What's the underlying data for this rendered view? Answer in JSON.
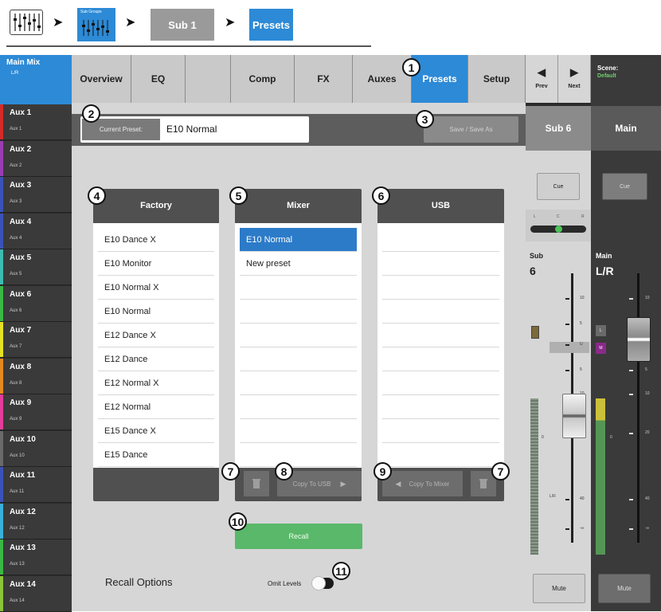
{
  "breadcrumb": {
    "subgroups_label": "Sub Groups",
    "sub_label": "Sub 1",
    "presets_label": "Presets"
  },
  "colors": {
    "accent": "#2d8ad6",
    "recall": "#5ab86a",
    "panel": "#505050"
  },
  "sidebar": {
    "main": {
      "name": "Main Mix",
      "sub": "L/R"
    },
    "items": [
      {
        "name": "Aux 1",
        "sub": "Aux 1",
        "color": "#d42a2a"
      },
      {
        "name": "Aux 2",
        "sub": "Aux 2",
        "color": "#9a3db3"
      },
      {
        "name": "Aux 3",
        "sub": "Aux 3",
        "color": "#3a52b8"
      },
      {
        "name": "Aux 4",
        "sub": "Aux 4",
        "color": "#3a52b8"
      },
      {
        "name": "Aux 5",
        "sub": "Aux 5",
        "color": "#3dbbb1"
      },
      {
        "name": "Aux 6",
        "sub": "Aux 6",
        "color": "#3ab845"
      },
      {
        "name": "Aux 7",
        "sub": "Aux 7",
        "color": "#e6e024"
      },
      {
        "name": "Aux 8",
        "sub": "Aux 8",
        "color": "#e38a1e"
      },
      {
        "name": "Aux 9",
        "sub": "Aux 9",
        "color": "#e23c9a"
      },
      {
        "name": "Aux 10",
        "sub": "Aux 10",
        "color": "#6a6a6a"
      },
      {
        "name": "Aux 11",
        "sub": "Aux 11",
        "color": "#3a52b8"
      },
      {
        "name": "Aux 12",
        "sub": "Aux 12",
        "color": "#3ab0d8"
      },
      {
        "name": "Aux 13",
        "sub": "Aux 13",
        "color": "#3ab845"
      },
      {
        "name": "Aux 14",
        "sub": "Aux 14",
        "color": "#8ac43a"
      }
    ]
  },
  "tabs": [
    "Overview",
    "EQ",
    "",
    "Comp",
    "FX",
    "Auxes",
    "Presets",
    "Setup"
  ],
  "nav": {
    "prev": "Prev",
    "next": "Next"
  },
  "scene": {
    "label": "Scene:",
    "value": "Default"
  },
  "preset": {
    "current_label": "Current Preset:",
    "current_value": "E10 Normal",
    "save_label": "Save / Save As"
  },
  "factory": {
    "title": "Factory",
    "items": [
      "E10 Dance X",
      "E10 Monitor",
      "E10 Normal X",
      "E10 Normal",
      "E12 Dance X",
      "E12 Dance",
      "E12 Normal X",
      "E12 Normal",
      "E15 Dance X",
      "E15 Dance"
    ]
  },
  "mixer": {
    "title": "Mixer",
    "items": [
      "E10 Normal",
      "New preset"
    ],
    "copy_label": "Copy To USB"
  },
  "usb": {
    "title": "USB",
    "copy_label": "Copy To Mixer"
  },
  "recall": {
    "label": "Recall",
    "options_label": "Recall Options",
    "omit_label": "Omit Levels"
  },
  "strip_sub": {
    "title": "Sub 6",
    "cue": "Cue",
    "name": "Sub",
    "num": "6",
    "meter_label": "L/R",
    "mute": "Mute",
    "pan_l": "L",
    "pan_c": "C",
    "pan_r": "R"
  },
  "strip_main": {
    "title": "Main",
    "cue": "Cue",
    "name": "Main",
    "num": "L/R",
    "mute": "Mute",
    "l_label": "L",
    "m_label": "M"
  },
  "scale": {
    "t10": "10",
    "t5": "5",
    "u": "U",
    "t5b": "5",
    "t10b": "10",
    "t20": "20",
    "t40": "40",
    "inf": "-∞",
    "zero": "0"
  },
  "callouts": [
    "1",
    "2",
    "3",
    "4",
    "5",
    "6",
    "7",
    "8",
    "9",
    "7",
    "10",
    "11"
  ]
}
